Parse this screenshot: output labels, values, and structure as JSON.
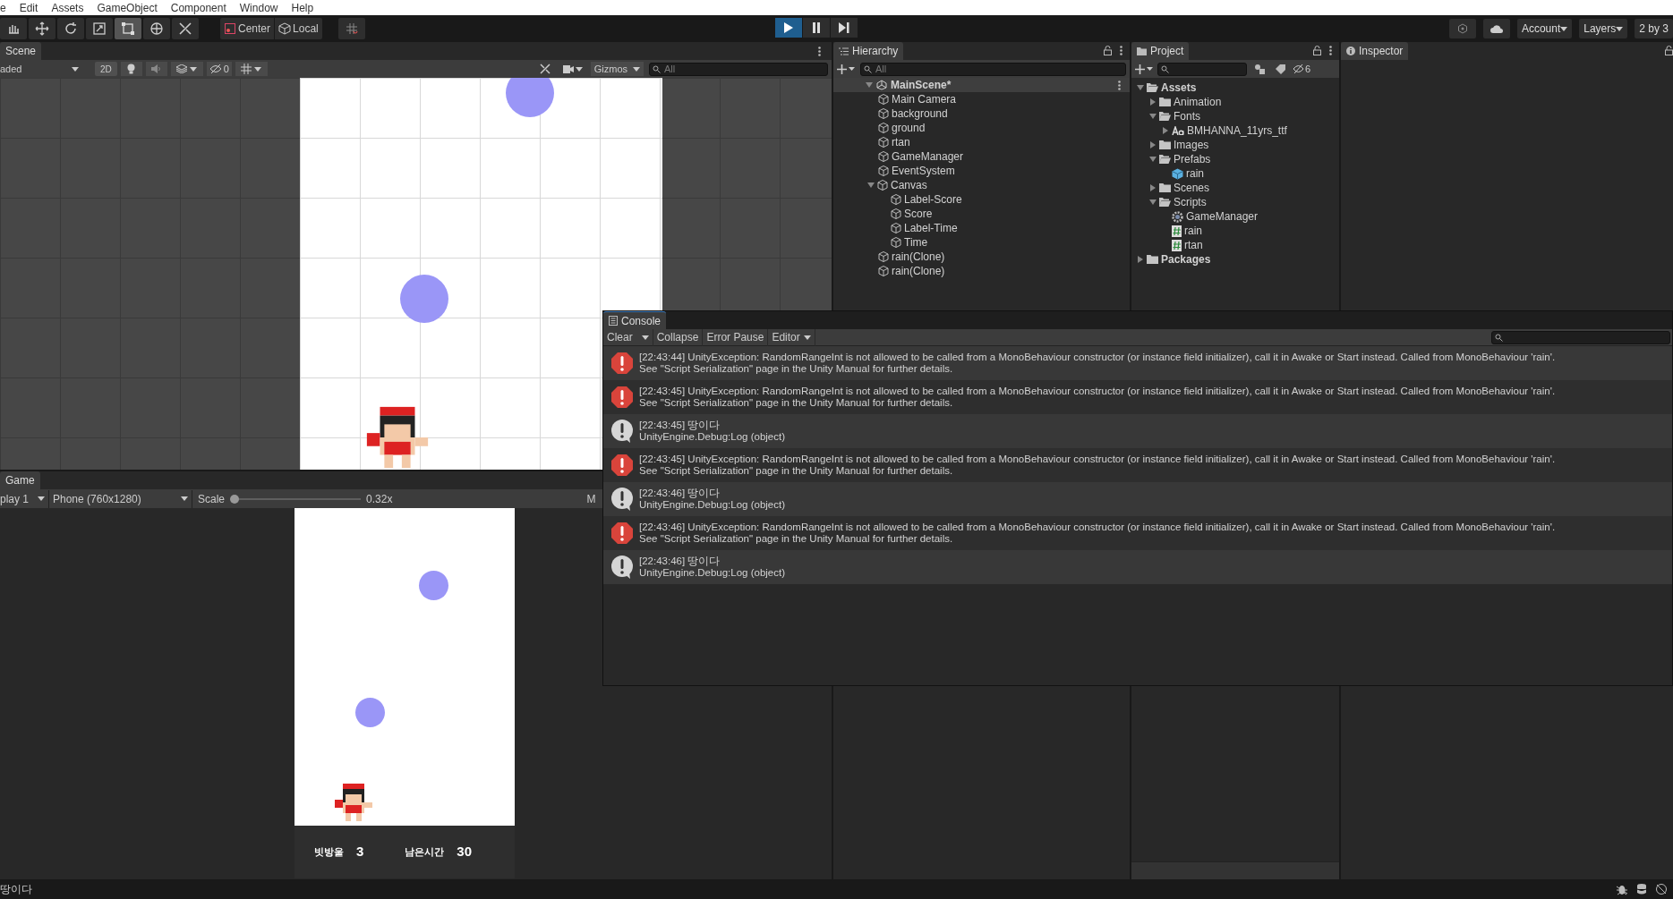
{
  "menu_bar": [
    "e",
    "Edit",
    "Assets",
    "GameObject",
    "Component",
    "Window",
    "Help"
  ],
  "toolbar": {
    "tools": [
      {
        "selected": false
      },
      {
        "selected": false
      },
      {
        "selected": false
      },
      {
        "selected": false
      },
      {
        "selected": true
      },
      {
        "selected": false
      },
      {
        "selected": false
      }
    ],
    "pivot": "Center",
    "space": "Local",
    "playing": true,
    "paused": false,
    "account": "Account",
    "layers": "Layers",
    "layout": "2 by 3"
  },
  "scene": {
    "tab": "Scene",
    "draw_mode": "aded",
    "mode_2d": "2D",
    "hidden_count": "0",
    "gizmos": "Gizmos",
    "search_placeholder": "All"
  },
  "hierarchy": {
    "tab": "Hierarchy",
    "search_placeholder": "All",
    "scene": "MainScene*",
    "items": [
      {
        "label": "Main Camera"
      },
      {
        "label": "background"
      },
      {
        "label": "ground"
      },
      {
        "label": "rtan"
      },
      {
        "label": "GameManager"
      },
      {
        "label": "EventSystem"
      },
      {
        "label": "Canvas",
        "expanded": true,
        "children": [
          {
            "label": "Label-Score"
          },
          {
            "label": "Score"
          },
          {
            "label": "Label-Time"
          },
          {
            "label": "Time"
          }
        ]
      },
      {
        "label": "rain(Clone)"
      },
      {
        "label": "rain(Clone)"
      }
    ]
  },
  "project": {
    "tab": "Project",
    "hidden_count": "6",
    "items": [
      {
        "label": "Assets",
        "kind": "folder",
        "expanded": true,
        "children": [
          {
            "label": "Animation",
            "kind": "folder",
            "expanded": false
          },
          {
            "label": "Fonts",
            "kind": "folder",
            "expanded": true,
            "children": [
              {
                "label": "BMHANNA_11yrs_ttf",
                "kind": "font",
                "expanded": false
              }
            ]
          },
          {
            "label": "Images",
            "kind": "folder",
            "expanded": false
          },
          {
            "label": "Prefabs",
            "kind": "folder",
            "expanded": true,
            "children": [
              {
                "label": "rain",
                "kind": "prefab"
              }
            ]
          },
          {
            "label": "Scenes",
            "kind": "folder",
            "expanded": false
          },
          {
            "label": "Scripts",
            "kind": "folder",
            "expanded": true,
            "children": [
              {
                "label": "GameManager",
                "kind": "gear"
              },
              {
                "label": "rain",
                "kind": "script"
              },
              {
                "label": "rtan",
                "kind": "script"
              }
            ]
          }
        ]
      },
      {
        "label": "Packages",
        "kind": "folder",
        "expanded": false
      }
    ]
  },
  "inspector": {
    "tab": "Inspector"
  },
  "console": {
    "tab": "Console",
    "buttons": [
      "Clear",
      "Collapse",
      "Error Pause",
      "Editor"
    ],
    "entries": [
      {
        "kind": "error",
        "text": "[22:43:44] UnityException: RandomRangeInt is not allowed to be called from a MonoBehaviour constructor (or instance field initializer), call it in Awake or Start instead. Called from MonoBehaviour 'rain'.",
        "detail": "See \"Script Serialization\" page in the Unity Manual for further details."
      },
      {
        "kind": "error",
        "text": "[22:43:45] UnityException: RandomRangeInt is not allowed to be called from a MonoBehaviour constructor (or instance field initializer), call it in Awake or Start instead. Called from MonoBehaviour 'rain'.",
        "detail": "See \"Script Serialization\" page in the Unity Manual for further details."
      },
      {
        "kind": "log",
        "text": "[22:43:45] 땅이다",
        "detail": "UnityEngine.Debug:Log (object)"
      },
      {
        "kind": "error",
        "text": "[22:43:45] UnityException: RandomRangeInt is not allowed to be called from a MonoBehaviour constructor (or instance field initializer), call it in Awake or Start instead. Called from MonoBehaviour 'rain'.",
        "detail": "See \"Script Serialization\" page in the Unity Manual for further details."
      },
      {
        "kind": "log",
        "text": "[22:43:46] 땅이다",
        "detail": "UnityEngine.Debug:Log (object)"
      },
      {
        "kind": "error",
        "text": "[22:43:46] UnityException: RandomRangeInt is not allowed to be called from a MonoBehaviour constructor (or instance field initializer), call it in Awake or Start instead. Called from MonoBehaviour 'rain'.",
        "detail": "See \"Script Serialization\" page in the Unity Manual for further details."
      },
      {
        "kind": "log",
        "text": "[22:43:46] 땅이다",
        "detail": "UnityEngine.Debug:Log (object)"
      }
    ]
  },
  "game": {
    "tab": "Game",
    "display": "play 1",
    "resolution": "Phone (760x1280)",
    "scale_label": "Scale",
    "scale": {
      "level": 0
    },
    "scale_value": "0.32x",
    "column_5": "M",
    "hud": [
      {
        "label": "빗방울",
        "value": "3"
      },
      {
        "label": "남은시간",
        "value": "30"
      }
    ]
  },
  "status_bar": "땅이다"
}
